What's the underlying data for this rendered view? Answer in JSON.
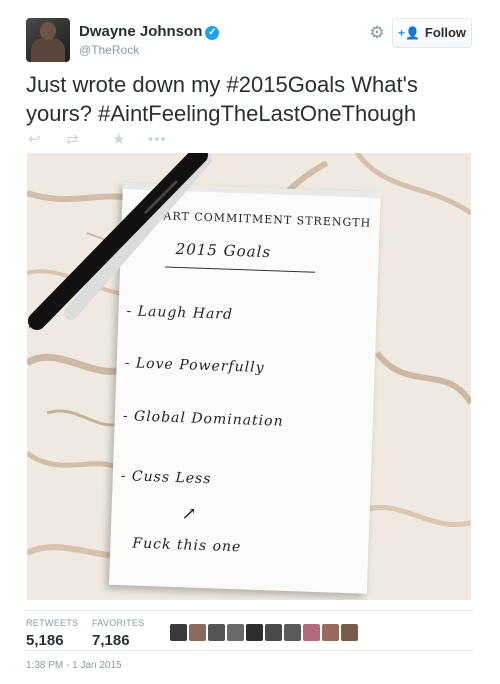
{
  "user": {
    "display_name": "Dwayne Johnson",
    "handle": "@TheRock",
    "verified": true
  },
  "header": {
    "follow_label": "Follow",
    "gear_icon": "gear-icon",
    "follow_icon": "add-person-icon"
  },
  "tweet": {
    "text": "Just wrote down my #2015Goals What's yours? #AintFeelingTheLastOneThough"
  },
  "actions": {
    "reply_icon": "reply-icon",
    "retweet_icon": "retweet-icon",
    "favorite_icon": "star-icon",
    "more_icon": "more-icon"
  },
  "photo": {
    "pad_header": "HEART COMMITMENT STRENGTH",
    "pad_title": "2015 Goals",
    "lines": [
      "- Laugh Hard",
      "- Love Powerfully",
      "- Global Domination",
      "- Cuss Less",
      "Fuck this one"
    ],
    "arrow": "↗"
  },
  "stats": {
    "retweets_label": "RETWEETS",
    "retweets_value": "5,186",
    "favorites_label": "FAVORITES",
    "favorites_value": "7,186"
  },
  "favoriters": {
    "count_shown": 10,
    "colors": [
      "#3a3a3a",
      "#8a6a5a",
      "#555555",
      "#6a6a6a",
      "#2e2e2e",
      "#4a4a4a",
      "#5a5a5a",
      "#b46a7a",
      "#9a6a5a",
      "#7a5a4a"
    ]
  },
  "timestamp": "1:38 PM - 1 Jan 2015",
  "colors": {
    "accent": "#1da1f2",
    "text": "#292f33",
    "muted": "#8899a6",
    "border": "#e1e8ed"
  }
}
